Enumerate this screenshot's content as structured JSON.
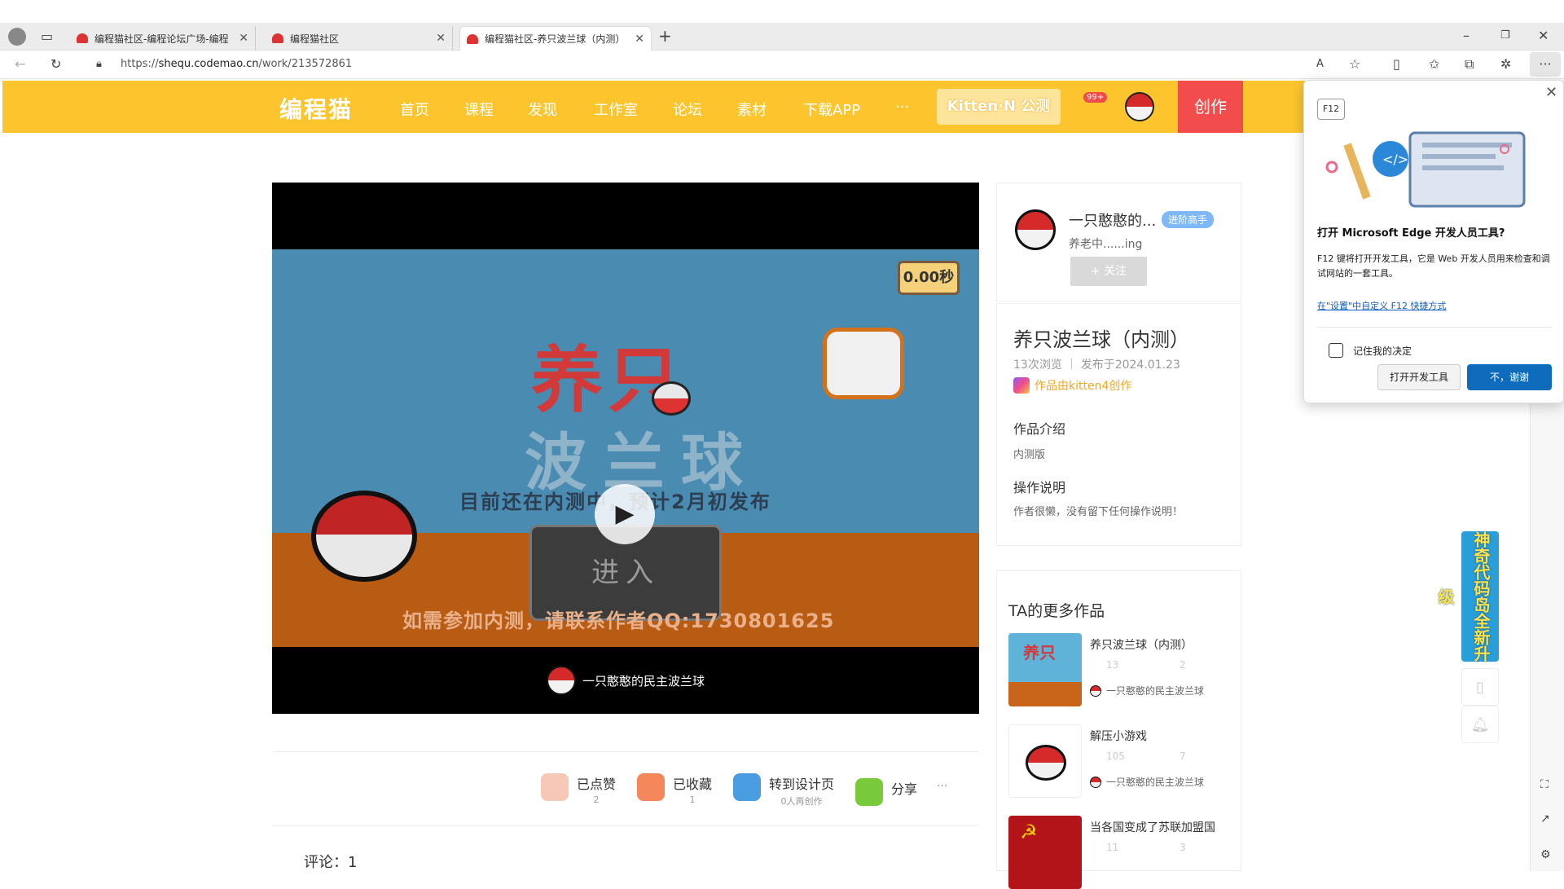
{
  "browser": {
    "tabs": [
      {
        "title": "编程猫社区-编程论坛广场-编程"
      },
      {
        "title": "编程猫社区"
      },
      {
        "title": "编程猫社区-养只波兰球（内测）"
      }
    ],
    "url_scheme": "https://",
    "url_host": "shequ.codemao.cn",
    "url_path": "/work/213572861"
  },
  "header": {
    "logo": "编程猫",
    "nav": [
      "首页",
      "课程",
      "发现",
      "工作室",
      "论坛",
      "素材",
      "下载APP",
      "···"
    ],
    "kitten_label": "Kitten·N 公测",
    "badge": "99+",
    "create_label": "创作"
  },
  "game": {
    "title1": "养只",
    "title2": "波兰球",
    "subline": "目前还在内测中，预计2月初发布",
    "enter": "进入",
    "contact": "如需参加内测，请联系作者QQ:1730801625",
    "timer": "0.00秒"
  },
  "player": {
    "author_name": "一只憨憨的民主波兰球"
  },
  "actions": [
    {
      "label": "已点赞",
      "sub": "2"
    },
    {
      "label": "已收藏",
      "sub": "1"
    },
    {
      "label": "转到设计页",
      "sub": "0人再创作"
    },
    {
      "label": "分享",
      "sub": ""
    }
  ],
  "more_icon": "···",
  "comments": "评论：1",
  "author": {
    "name": "一只憨憨的...",
    "level": "进阶高手",
    "motto": "养老中......ing",
    "follow": "+ 关注"
  },
  "work": {
    "title": "养只波兰球（内测）",
    "meta": "13次浏览 ｜ 发布于2024.01.23",
    "made_by": "作品由kitten4创作",
    "intro_h": "作品介绍",
    "intro": "内测版",
    "howto_h": "操作说明",
    "howto": "作者很懒，没有留下任何操作说明！"
  },
  "more_works": {
    "title": "TA的更多作品",
    "items": [
      {
        "name": "养只波兰球（内测）",
        "views": "13",
        "likes": "2",
        "author": "一只憨憨的民主波兰球"
      },
      {
        "name": "解压小游戏",
        "views": "105",
        "likes": "7",
        "author": "一只憨憨的民主波兰球"
      },
      {
        "name": "当各国变成了苏联加盟国",
        "views": "11",
        "likes": "3",
        "author": ""
      }
    ]
  },
  "promo": "神奇代码岛全新升级",
  "popup": {
    "key": "F12",
    "title": "打开 Microsoft Edge 开发人员工具?",
    "desc": "F12 键将打开开发工具，它是 Web 开发人员用来检查和调试网站的一套工具。",
    "link": "在\"设置\"中自定义 F12 快捷方式",
    "remember": "记住我的决定",
    "open_btn": "打开开发工具",
    "no_btn": "不，谢谢"
  },
  "colors": {
    "header": "#fcc42d",
    "create": "#f24c4c",
    "edge_blue": "#0f6cbd"
  }
}
